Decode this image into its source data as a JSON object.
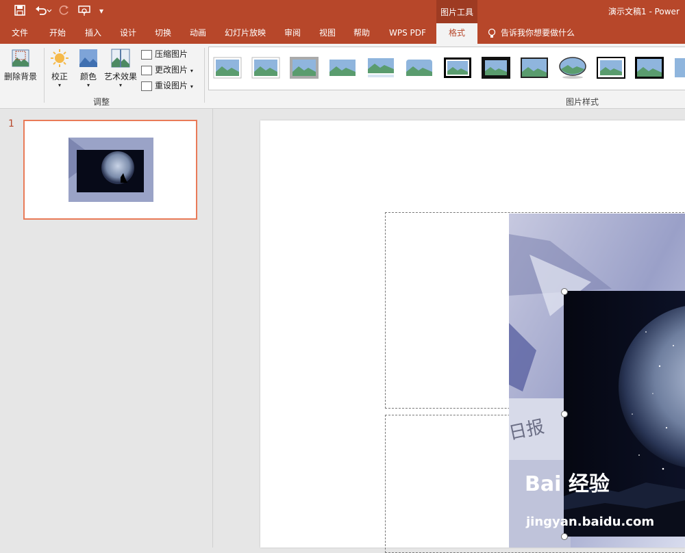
{
  "quick_access": {
    "save_icon": "save-icon",
    "undo_icon": "undo-icon",
    "redo_icon": "redo-icon",
    "present_icon": "present-icon",
    "customize_icon": "customize-icon"
  },
  "title": {
    "context_group": "图片工具",
    "app_title": "演示文稿1  -  Power"
  },
  "tabs": [
    "文件",
    "开始",
    "插入",
    "设计",
    "切换",
    "动画",
    "幻灯片放映",
    "审阅",
    "视图",
    "帮助",
    "WPS PDF",
    "格式"
  ],
  "active_tab": "格式",
  "tell_me": "告诉我你想要做什么",
  "ribbon": {
    "remove_bg": "删除背景",
    "correct": "校正",
    "color": "颜色",
    "artistic": "艺术效果",
    "compress": "压缩图片",
    "change": "更改图片",
    "reset": "重设图片",
    "group_adjust": "调整",
    "group_styles": "图片样式"
  },
  "slides": {
    "number": "1"
  },
  "watermark": {
    "brand": "Bai  经验",
    "url": "jingyan.baidu.com"
  },
  "colors": {
    "accent": "#b7472a",
    "selection": "#e97a57"
  }
}
